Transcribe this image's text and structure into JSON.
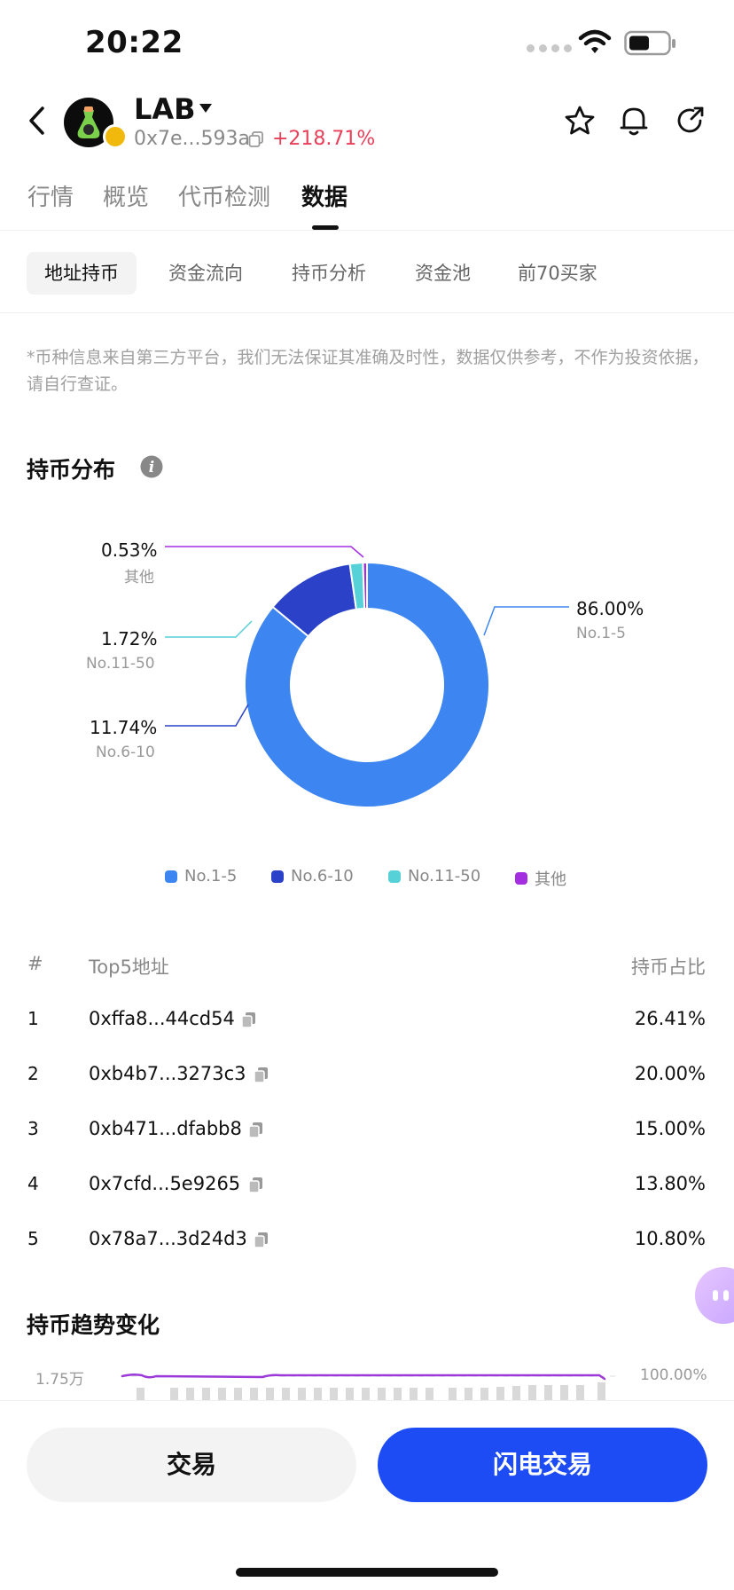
{
  "status_bar": {
    "time": "20:22"
  },
  "header": {
    "token_name": "LAB",
    "token_address": "0x7e...593a",
    "price_change": "+218.71%"
  },
  "main_tabs": [
    {
      "label": "行情",
      "active": false
    },
    {
      "label": "概览",
      "active": false
    },
    {
      "label": "代币检测",
      "active": false
    },
    {
      "label": "数据",
      "active": true
    }
  ],
  "sub_tabs": [
    {
      "label": "地址持币",
      "active": true
    },
    {
      "label": "资金流向",
      "active": false
    },
    {
      "label": "持币分析",
      "active": false
    },
    {
      "label": "资金池",
      "active": false
    },
    {
      "label": "前70买家",
      "active": false
    }
  ],
  "disclaimer": "*币种信息来自第三方平台，我们无法保证其准确及时性，数据仅供参考，不作为投资依据，请自行查证。",
  "distribution": {
    "title": "持币分布",
    "labels": [
      {
        "value": "0.53%",
        "category": "其他"
      },
      {
        "value": "1.72%",
        "category": "No.11-50"
      },
      {
        "value": "11.74%",
        "category": "No.6-10"
      },
      {
        "value": "86.00%",
        "category": "No.1-5"
      }
    ]
  },
  "chart_data": {
    "type": "pie",
    "categories": [
      "No.1-5",
      "No.6-10",
      "No.11-50",
      "其他"
    ],
    "values": [
      86.0,
      11.74,
      1.72,
      0.53
    ],
    "colors": [
      "#3d85f0",
      "#2a41c8",
      "#56d1d8",
      "#a32ee0"
    ],
    "legend": "bottom"
  },
  "legend": [
    {
      "label": "No.1-5",
      "color": "#3d85f0"
    },
    {
      "label": "No.6-10",
      "color": "#2a41c8"
    },
    {
      "label": "No.11-50",
      "color": "#56d1d8"
    },
    {
      "label": "其他",
      "color": "#a32ee0"
    }
  ],
  "holders_table": {
    "headers": {
      "rank": "#",
      "address": "Top5地址",
      "share": "持币占比"
    },
    "rows": [
      {
        "rank": "1",
        "address": "0xffa8...44cd54",
        "share": "26.41%"
      },
      {
        "rank": "2",
        "address": "0xb4b7...3273c3",
        "share": "20.00%"
      },
      {
        "rank": "3",
        "address": "0xb471...dfabb8",
        "share": "15.00%"
      },
      {
        "rank": "4",
        "address": "0x7cfd...5e9265",
        "share": "13.80%"
      },
      {
        "rank": "5",
        "address": "0x78a7...3d24d3",
        "share": "10.80%"
      }
    ]
  },
  "trend": {
    "title": "持币趋势变化",
    "left_axis_top": "1.75万",
    "right_axis_top": "100.00%"
  },
  "bottom_bar": {
    "trade_label": "交易",
    "flash_trade_label": "闪电交易"
  },
  "colors": {
    "accent_blue": "#1d4cf5",
    "positive": "#e8405a"
  }
}
